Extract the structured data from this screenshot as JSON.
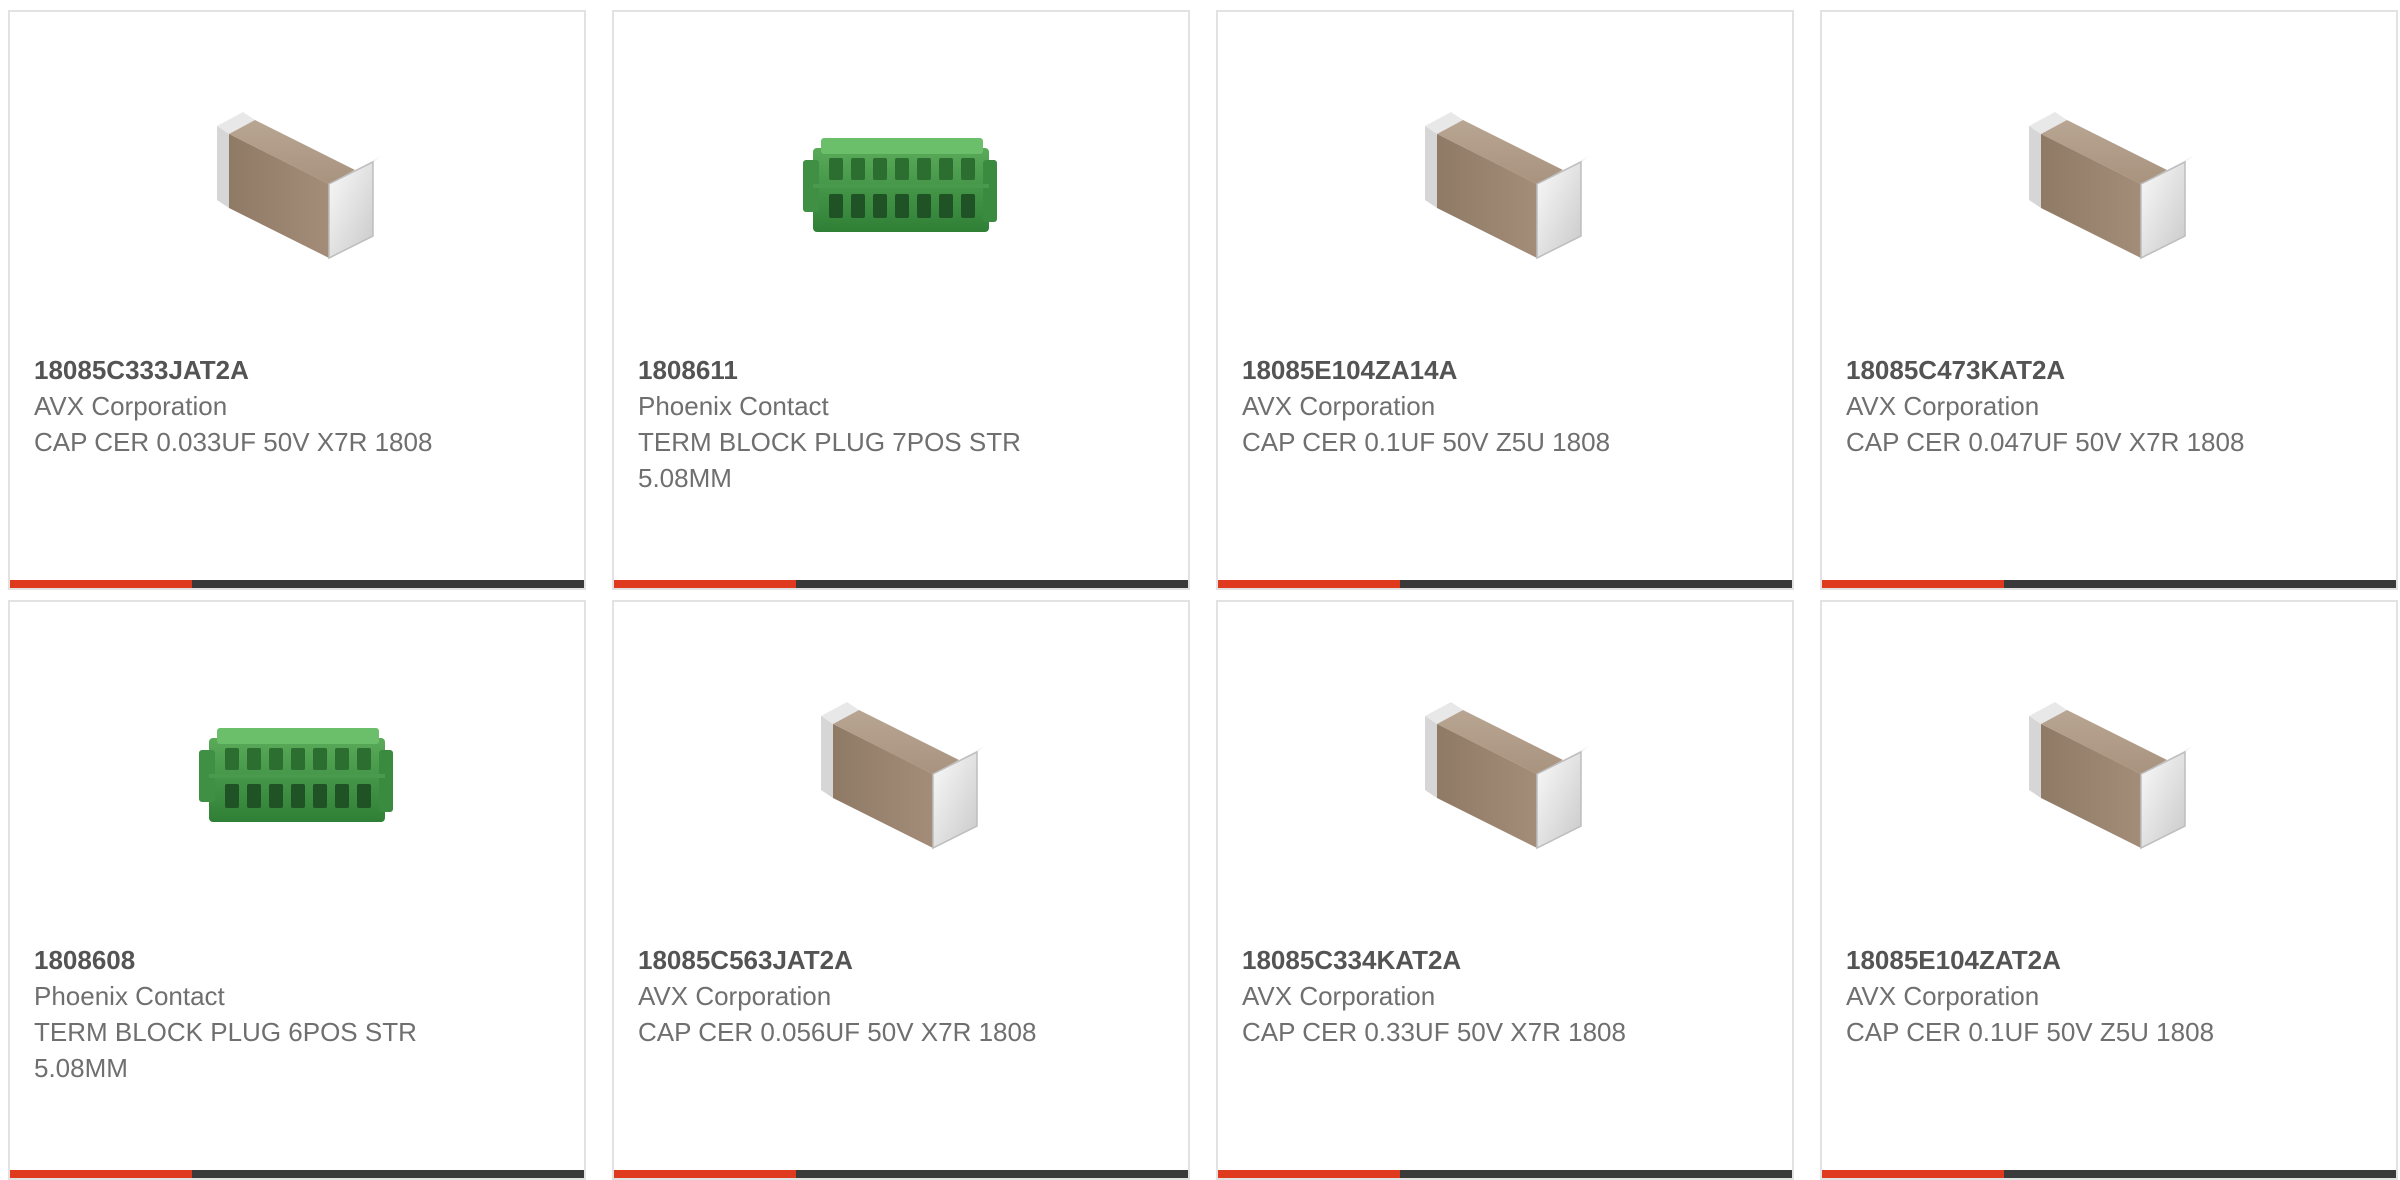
{
  "theme": {
    "accent": "#e03a1e",
    "bar": "#3a3a3a",
    "border": "#e2e2e2"
  },
  "products": [
    {
      "part": "18085C333JAT2A",
      "maker": "AVX Corporation",
      "desc": "CAP CER 0.033UF 50V X7R 1808",
      "icon": "capacitor-chip-image"
    },
    {
      "part": "1808611",
      "maker": "Phoenix Contact",
      "desc": "TERM BLOCK PLUG 7POS STR 5.08MM",
      "icon": "terminal-block-image"
    },
    {
      "part": "18085E104ZA14A",
      "maker": "AVX Corporation",
      "desc": "CAP CER 0.1UF 50V Z5U 1808",
      "icon": "capacitor-chip-image"
    },
    {
      "part": "18085C473KAT2A",
      "maker": "AVX Corporation",
      "desc": "CAP CER 0.047UF 50V X7R 1808",
      "icon": "capacitor-chip-image"
    },
    {
      "part": "1808608",
      "maker": "Phoenix Contact",
      "desc": "TERM BLOCK PLUG 6POS STR 5.08MM",
      "icon": "terminal-block-image"
    },
    {
      "part": "18085C563JAT2A",
      "maker": "AVX Corporation",
      "desc": "CAP CER 0.056UF 50V X7R 1808",
      "icon": "capacitor-chip-image"
    },
    {
      "part": "18085C334KAT2A",
      "maker": "AVX Corporation",
      "desc": "CAP CER 0.33UF 50V X7R 1808",
      "icon": "capacitor-chip-image"
    },
    {
      "part": "18085E104ZAT2A",
      "maker": "AVX Corporation",
      "desc": "CAP CER 0.1UF 50V Z5U 1808",
      "icon": "capacitor-chip-image"
    }
  ]
}
